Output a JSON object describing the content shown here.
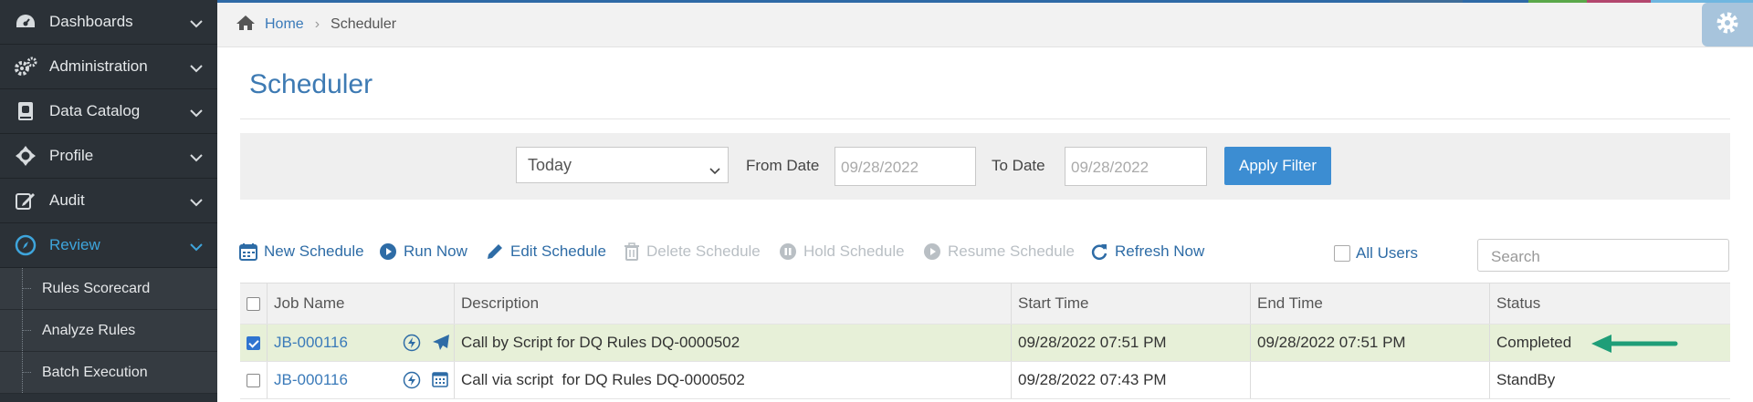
{
  "sidebar": {
    "items": [
      {
        "label": "Dashboards"
      },
      {
        "label": "Administration"
      },
      {
        "label": "Data Catalog"
      },
      {
        "label": "Profile"
      },
      {
        "label": "Audit"
      },
      {
        "label": "Review"
      }
    ],
    "subitems": [
      {
        "label": "Rules Scorecard"
      },
      {
        "label": "Analyze Rules"
      },
      {
        "label": "Batch Execution"
      }
    ]
  },
  "breadcrumb": {
    "home": "Home",
    "separator": "›",
    "current": "Scheduler"
  },
  "page": {
    "title": "Scheduler"
  },
  "filter": {
    "period": "Today",
    "from_label": "From Date",
    "from_placeholder": "09/28/2022",
    "to_label": "To Date",
    "to_placeholder": "09/28/2022",
    "apply_label": "Apply Filter"
  },
  "toolbar": {
    "new_schedule": "New Schedule",
    "run_now": "Run Now",
    "edit_schedule": "Edit Schedule",
    "delete_schedule": "Delete Schedule",
    "hold_schedule": "Hold Schedule",
    "resume_schedule": "Resume Schedule",
    "refresh_now": "Refresh Now",
    "all_users": "All Users",
    "search_placeholder": "Search"
  },
  "table": {
    "headers": {
      "job_name": "Job Name",
      "description": "Description",
      "start_time": "Start Time",
      "end_time": "End Time",
      "status": "Status"
    },
    "rows": [
      {
        "job": "JB-000116",
        "description": "Call by Script for DQ Rules DQ-0000502",
        "start": "09/28/2022 07:51 PM",
        "end": "09/28/2022 07:51 PM",
        "status": "Completed",
        "selected": true
      },
      {
        "job": "JB-000116",
        "description": "Call via script  for DQ Rules DQ-0000502",
        "start": "09/28/2022 07:43 PM",
        "end": "",
        "status": "StandBy",
        "selected": false
      }
    ]
  },
  "colors": {
    "accent": "#3a7ab9",
    "selected_row": "#e7f0d8",
    "arrow": "#1f9e78",
    "sidebar": "#2b3137"
  }
}
